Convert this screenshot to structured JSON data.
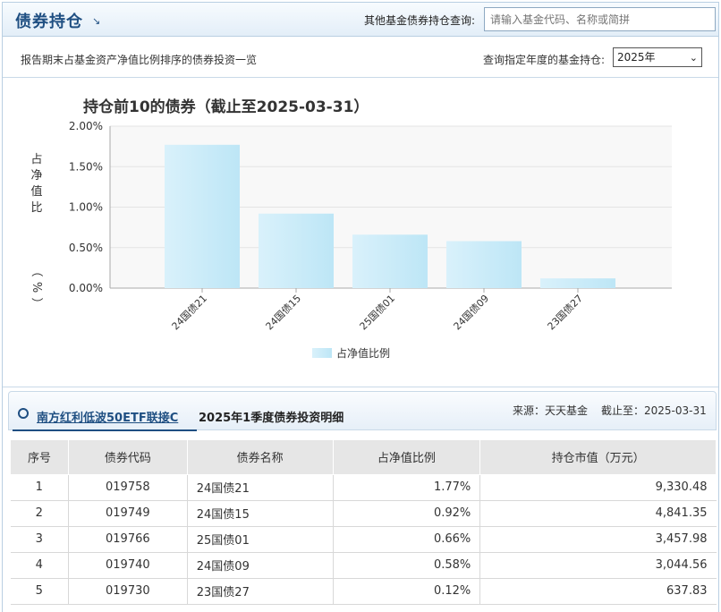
{
  "header": {
    "title": "债券持仓",
    "arrow": "↘",
    "search_label": "其他基金债券持仓查询:",
    "search_placeholder": "请输入基金代码、名称或简拼"
  },
  "subbar": {
    "description": "报告期末占基金资产净值比例排序的债券投资一览",
    "year_label": "查询指定年度的基金持仓:",
    "year_value": "2025年",
    "caret": "⌄"
  },
  "chart_data": {
    "type": "bar",
    "title": "持仓前10的债券（截止至2025-03-31）",
    "ylabel": "占净值比（%）",
    "xlabel": "",
    "categories": [
      "24国债21",
      "24国债15",
      "25国债01",
      "24国债09",
      "23国债27"
    ],
    "series": [
      {
        "name": "占净值比例",
        "values": [
          1.77,
          0.92,
          0.66,
          0.58,
          0.12
        ]
      }
    ],
    "ylim": [
      0,
      2
    ],
    "yticks": [
      "0.00%",
      "0.50%",
      "1.00%",
      "1.50%",
      "2.00%"
    ],
    "grid": true,
    "legend": "bottom-center",
    "color": "#bde6f6"
  },
  "detail": {
    "fund_name": "南方红利低波50ETF联接C",
    "quarter_title": "2025年1季度债券投资明细",
    "source": "来源：天天基金",
    "as_of": "截止至：2025-03-31",
    "columns": [
      "序号",
      "债券代码",
      "债券名称",
      "占净值比例",
      "持仓市值（万元）"
    ],
    "rows": [
      [
        "1",
        "019758",
        "24国债21",
        "1.77%",
        "9,330.48"
      ],
      [
        "2",
        "019749",
        "24国债15",
        "0.92%",
        "4,841.35"
      ],
      [
        "3",
        "019766",
        "25国债01",
        "0.66%",
        "3,457.98"
      ],
      [
        "4",
        "019740",
        "24国债09",
        "0.58%",
        "3,044.56"
      ],
      [
        "5",
        "019730",
        "23国债27",
        "0.12%",
        "637.83"
      ]
    ]
  }
}
